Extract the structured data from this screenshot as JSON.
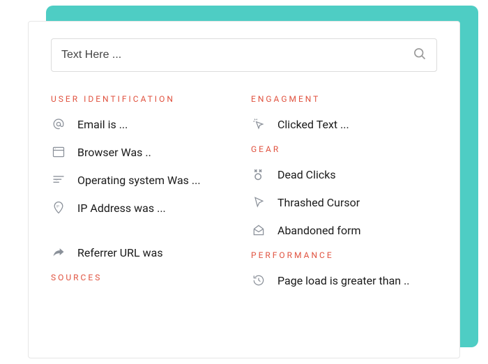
{
  "search": {
    "placeholder": "Text Here ..."
  },
  "sections": {
    "user_identification": {
      "header": "USER IDENTIFICATION",
      "items": [
        {
          "label": "Email is ..."
        },
        {
          "label": "Browser Was .."
        },
        {
          "label": "Operating system Was ..."
        },
        {
          "label": "IP Address was ..."
        }
      ]
    },
    "sources": {
      "header": "SOURCES",
      "items": [
        {
          "label": "Referrer URL was"
        }
      ]
    },
    "engagement": {
      "header": "ENGAGMENT",
      "items": [
        {
          "label": "Clicked Text ..."
        }
      ]
    },
    "gear": {
      "header": "GEAR",
      "items": [
        {
          "label": "Dead Clicks"
        },
        {
          "label": "Thrashed Cursor"
        },
        {
          "label": "Abandoned form"
        }
      ]
    },
    "performance": {
      "header": "PERFORMANCE",
      "items": [
        {
          "label": "Page load is greater than .."
        }
      ]
    }
  }
}
